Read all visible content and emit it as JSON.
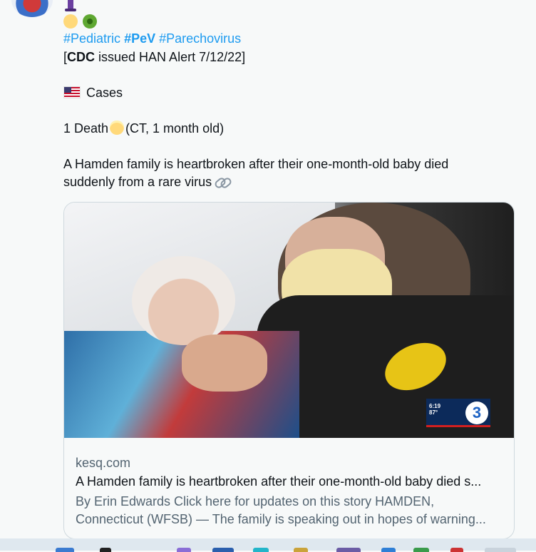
{
  "tweet": {
    "hashtags": [
      "#Pediatric",
      "#PeV",
      "#Parechovirus"
    ],
    "alert_open": "[",
    "alert_bold": "CDC",
    "alert_rest": " issued HAN Alert 7/12/22]",
    "cases_label": "Cases",
    "death_prefix": "1 Death",
    "death_detail": "(CT, 1 month old)",
    "description": "A Hamden family is heartbroken after their one-month-old baby died suddenly from a rare virus",
    "icons": [
      "test-tube-icon",
      "baby-icon",
      "microbe-icon",
      "us-flag-icon",
      "angel-icon",
      "link-icon"
    ]
  },
  "card": {
    "domain": "kesq.com",
    "title": "A Hamden family is heartbroken after their one-month-old baby died s...",
    "desc_line1": "By Erin Edwards Click here for updates on this story     HAMDEN,",
    "desc_line2": "Connecticut (WFSB) — The family is speaking out in hopes of warning...",
    "overlay_time": "6:19",
    "overlay_temp": "87°",
    "overlay_logo": "3"
  }
}
